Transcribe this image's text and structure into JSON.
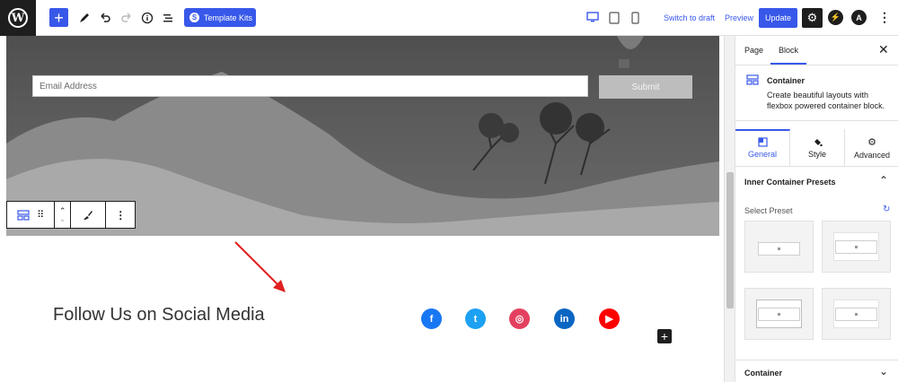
{
  "toolbar": {
    "template_kits_label": "Template Kits",
    "switch_to_draft_label": "Switch to draft",
    "preview_label": "Preview",
    "update_label": "Update",
    "icons": [
      "wordpress-logo-icon",
      "add-block-icon",
      "edit-pencil-icon",
      "undo-icon",
      "redo-icon",
      "info-icon",
      "list-view-icon",
      "desktop-icon",
      "tablet-icon",
      "mobile-icon",
      "settings-gear-icon",
      "bolt-icon",
      "astra-icon",
      "more-options-icon"
    ],
    "accent_color": "#3858e9"
  },
  "canvas": {
    "email_placeholder": "Email Address",
    "submit_label": "Submit",
    "follow_title": "Follow Us on Social Media",
    "social_icons": [
      {
        "name": "facebook",
        "glyph": "f",
        "color": "#1877f2"
      },
      {
        "name": "twitter",
        "glyph": "t",
        "color": "#1da1f2"
      },
      {
        "name": "instagram",
        "glyph": "◎",
        "color": "#e4405f"
      },
      {
        "name": "linkedin",
        "glyph": "in",
        "color": "#0a66c2"
      },
      {
        "name": "youtube",
        "glyph": "▶",
        "color": "#ff0000"
      }
    ]
  },
  "sidebar": {
    "tab_page": "Page",
    "tab_block": "Block",
    "block_name": "Container",
    "block_description": "Create beautiful layouts with flexbox powered container block.",
    "tabs": {
      "general": "General",
      "style": "Style",
      "advanced": "Advanced"
    },
    "presets_heading": "Inner Container Presets",
    "select_preset_label": "Select Preset",
    "container_section": "Container"
  }
}
